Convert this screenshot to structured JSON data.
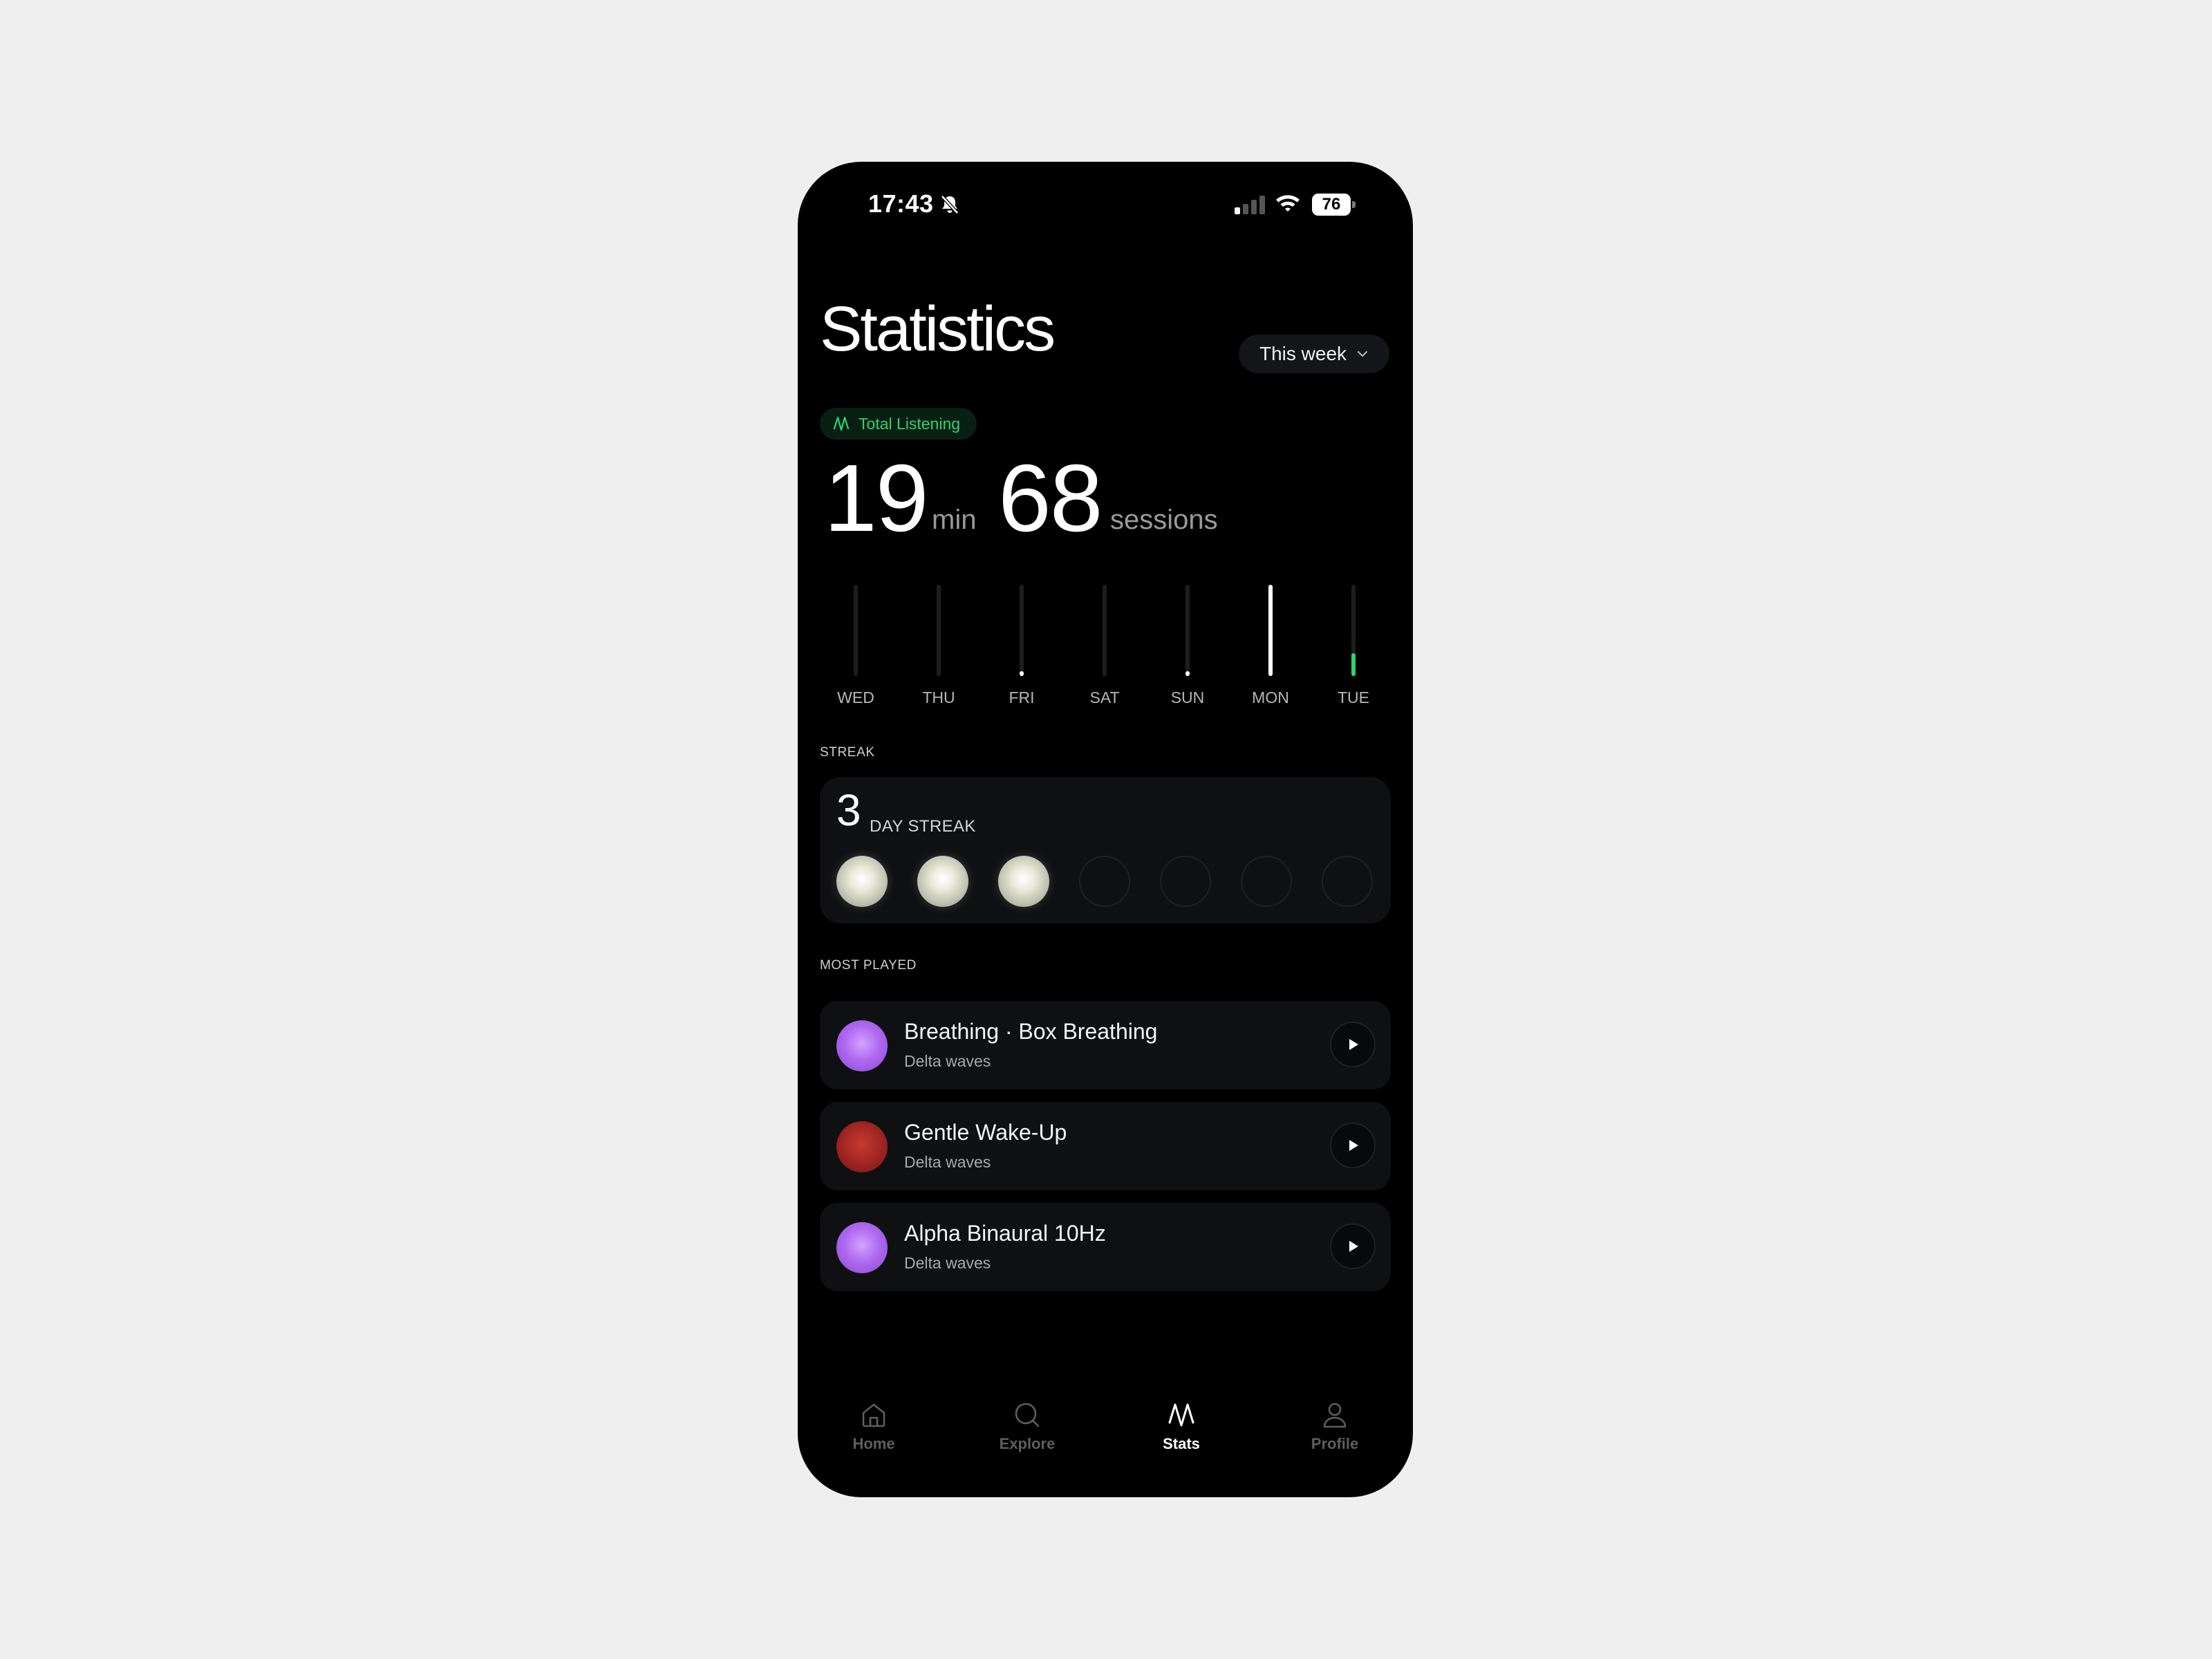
{
  "status_bar": {
    "time": "17:43",
    "battery": "76"
  },
  "header": {
    "title": "Statistics",
    "period": "This week"
  },
  "summary": {
    "badge": "Total Listening",
    "minutes": "19",
    "minutes_unit": "min",
    "sessions": "68",
    "sessions_unit": "sessions"
  },
  "week": [
    {
      "day": "WED",
      "level": 0,
      "color": "#ffffff"
    },
    {
      "day": "THU",
      "level": 0,
      "color": "#ffffff"
    },
    {
      "day": "FRI",
      "level": 0.05,
      "color": "#ffffff"
    },
    {
      "day": "SAT",
      "level": 0,
      "color": "#ffffff"
    },
    {
      "day": "SUN",
      "level": 0.05,
      "color": "#ffffff"
    },
    {
      "day": "MON",
      "level": 1,
      "color": "#ffffff"
    },
    {
      "day": "TUE",
      "level": 0.25,
      "color": "#2dd36f"
    }
  ],
  "streak": {
    "section_label": "STREAK",
    "count": "3",
    "label": "DAY STREAK",
    "filled_days": 3
  },
  "most_played": {
    "section_label": "MOST PLAYED",
    "items": [
      {
        "title": "Breathing · Box Breathing",
        "subtitle": "Delta waves",
        "orb": "purple"
      },
      {
        "title": "Gentle Wake-Up",
        "subtitle": "Delta waves",
        "orb": "red"
      },
      {
        "title": "Alpha Binaural 10Hz",
        "subtitle": "Delta waves",
        "orb": "purple"
      }
    ]
  },
  "nav": {
    "home": "Home",
    "explore": "Explore",
    "stats": "Stats",
    "profile": "Profile",
    "active": "stats"
  },
  "colors": {
    "accent": "#2dd36f",
    "background": "#000000",
    "card": "#0f1012"
  }
}
